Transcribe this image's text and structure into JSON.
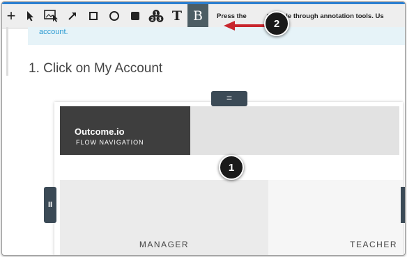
{
  "toolbar": {
    "tools": [
      {
        "name": "add-tool",
        "glyph": "+"
      },
      {
        "name": "select-tool"
      },
      {
        "name": "image-tool"
      },
      {
        "name": "arrow-tool"
      },
      {
        "name": "rectangle-tool"
      },
      {
        "name": "ellipse-tool"
      },
      {
        "name": "filled-rect-tool"
      },
      {
        "name": "numbered-step-tool",
        "glyph": "123"
      },
      {
        "name": "text-tool",
        "glyph": "T"
      },
      {
        "name": "bold-tool",
        "glyph": "B",
        "active": true
      }
    ],
    "hint": "Press the           to cycle through annotation tools. Us"
  },
  "banner": {
    "text": "account."
  },
  "step": {
    "heading": "1. Click on My Account"
  },
  "handles": {
    "top": "=",
    "left": "II"
  },
  "app": {
    "brand_title": "Outcome.io",
    "brand_subtitle": "FLOW NAVIGATION",
    "cards": [
      {
        "label": "MANAGER"
      },
      {
        "label": "TEACHER"
      }
    ]
  },
  "annotations": {
    "badge_1": "1",
    "badge_2": "2",
    "arrow_color": "#c8262d"
  }
}
